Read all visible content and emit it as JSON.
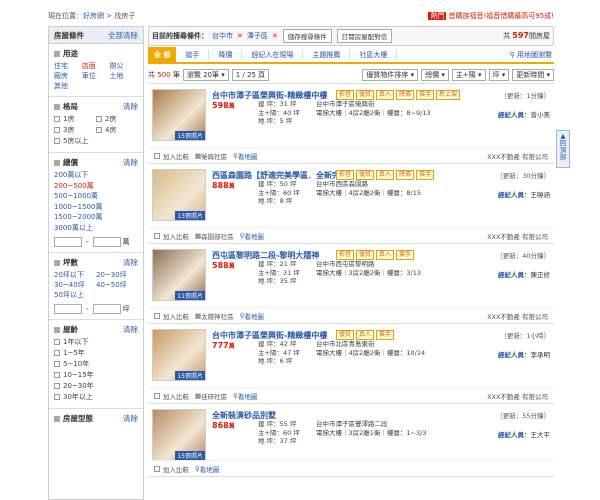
{
  "topbar": {
    "location_prefix": "現在位置：",
    "crumb1": "好房網",
    "sep": " > ",
    "crumb2": "找房子"
  },
  "promo": {
    "tag": "熱門",
    "text": "首購族福音!福音惜購最高可95成!"
  },
  "sidebar": {
    "header": "房屋條件",
    "header_link": "全部清除",
    "use": {
      "title": "用途",
      "items": [
        "住宅",
        "店面",
        "辦公",
        "廠房",
        "車位",
        "土地",
        "其他"
      ]
    },
    "rooms": {
      "title": "格局",
      "clear": "清除",
      "items": [
        "1房",
        "2房",
        "3房",
        "4房",
        "5房以上"
      ]
    },
    "price": {
      "title": "總價",
      "clear": "清除",
      "items": [
        "200萬以下",
        "200~500萬",
        "500~1000萬",
        "1000~1500萬",
        "1500~2000萬",
        "3000萬以上"
      ],
      "unit": "萬"
    },
    "size": {
      "title": "坪數",
      "clear": "清除",
      "items": [
        "20坪以下",
        "20~30坪",
        "30~40坪",
        "40~50坪",
        "50坪以上"
      ],
      "unit": "坪"
    },
    "age": {
      "title": "屋齡",
      "clear": "清除",
      "items": [
        "1年以下",
        "1~5年",
        "5~10年",
        "10~15年",
        "20~30年",
        "30年以上"
      ]
    },
    "type": {
      "title": "房屋型態",
      "clear": "清除"
    }
  },
  "cond": {
    "label": "目前的搜尋條件：",
    "city": "台中市",
    "x": "✕",
    "dist": "潭子區",
    "save": "儲存搜尋條件",
    "subscribe": "訂閱房屋配對信",
    "count_pre": "共",
    "count": "597",
    "count_post": "間房屋"
  },
  "tabs": {
    "all": "全 部",
    "items": [
      "搶手",
      "降價",
      "經紀人在現場",
      "主題推薦",
      "社區大樓"
    ],
    "map": "用地圖瀏覽"
  },
  "sort": {
    "total_pre": "共",
    "total": "500",
    "total_post": "筆",
    "per": "瀏覽 20筆",
    "page": "1 / 25 頁",
    "sort1": "優質物件排序",
    "sort2": "總價",
    "sort3": "主+陽",
    "sort4": "坪",
    "sort5": "更新時間"
  },
  "listings": [
    {
      "title": "台中市潭子區榮興街-精緻樓中樓",
      "badges": [
        "影音",
        "優質",
        "真人",
        "降價",
        "搶手",
        "新上架"
      ],
      "update": "（更新：1分鐘）",
      "price": "598",
      "unit": "萬",
      "specs": [
        "建  坪：31 坪",
        "主+陽：40 坪",
        "地  坪：5 坪"
      ],
      "addr": [
        "台中市潭子區榮興街",
        "電梯大樓｜4房2廳2衛｜樓層：8~9/13"
      ],
      "agent_label": "經紀人員",
      "agent": "曾小美",
      "photos": "15張照片",
      "community": "榮興社區",
      "company": "XXX不動產 有限公司",
      "color": "#a97a4a"
    },
    {
      "title": "西區森園路【舒適完美學區．全新完工】",
      "badges": [
        "影音",
        "優質",
        "真人",
        "降價",
        "搶手"
      ],
      "update": "（更新：30分鐘）",
      "price": "888",
      "unit": "萬",
      "specs": [
        "建  坪：50 坪",
        "主+陽：60 坪",
        "地  坪：8 坪"
      ],
      "addr": [
        "台中市西區森園路",
        "電梯大樓｜4房2廳2衛｜樓層：8/15"
      ],
      "agent_label": "經紀人員",
      "agent": "王曉涵",
      "photos": "13張照片",
      "community": "森園部社區",
      "company": "XXX不動產 有限公司",
      "color": "#d6b98a"
    },
    {
      "title": "西屯區黎明路二段-黎明大隱神",
      "badges": [
        "影音",
        "優質",
        "真人",
        "搶手"
      ],
      "update": "（更新：40分鐘）",
      "price": "588",
      "unit": "萬",
      "specs": [
        "建  坪：21 坪",
        "主+陽：31 坪",
        "地  坪：35 坪"
      ],
      "addr": [
        "台中市西屯區黎明路",
        "電梯大樓｜3房2廳2衛｜樓層：3/13"
      ],
      "agent_label": "經紀人員",
      "agent": "陳正修",
      "photos": "11張照片",
      "community": "太陽神社區",
      "company": "XXX不動產 有限公司",
      "color": "#8a6f52"
    },
    {
      "title": "台中市潭子區榮興街-精緻樓中樓",
      "badges": [
        "優質",
        "真人",
        "搶手"
      ],
      "update": "（更新：1小時）",
      "price": "777",
      "unit": "萬",
      "specs": [
        "建  坪：42 坪",
        "主+陽：47 坪",
        "地  坪：6 坪"
      ],
      "addr": [
        "台中市北區青島東街",
        "電梯大樓｜4房2廳2衛｜樓層：10/14"
      ],
      "agent_label": "經紀人員",
      "agent": "李承明",
      "photos": "15張照片",
      "community": "佳研社區",
      "company": "XXX不動產 有限公司",
      "color": "#c89a62"
    },
    {
      "title": "全新裝潢砂品別墅",
      "badges": [],
      "update": "（更新：55分鐘）",
      "price": "868",
      "unit": "萬",
      "specs": [
        "建  坪：55 坪",
        "主+陽：60 坪",
        "地  坪：37 坪"
      ],
      "addr": [
        "台中市潭子區豐澤路二段",
        "電梯大樓｜3房2廳1衛｜樓層：1~3/3"
      ],
      "agent_label": "經紀人員",
      "agent": "王大平",
      "photos": "15張照片",
      "community": "",
      "company": "",
      "color": "#b68b66"
    }
  ],
  "foot": {
    "compare": "加入比較",
    "map": "看地圖"
  },
  "scrolltop": "回頂部"
}
